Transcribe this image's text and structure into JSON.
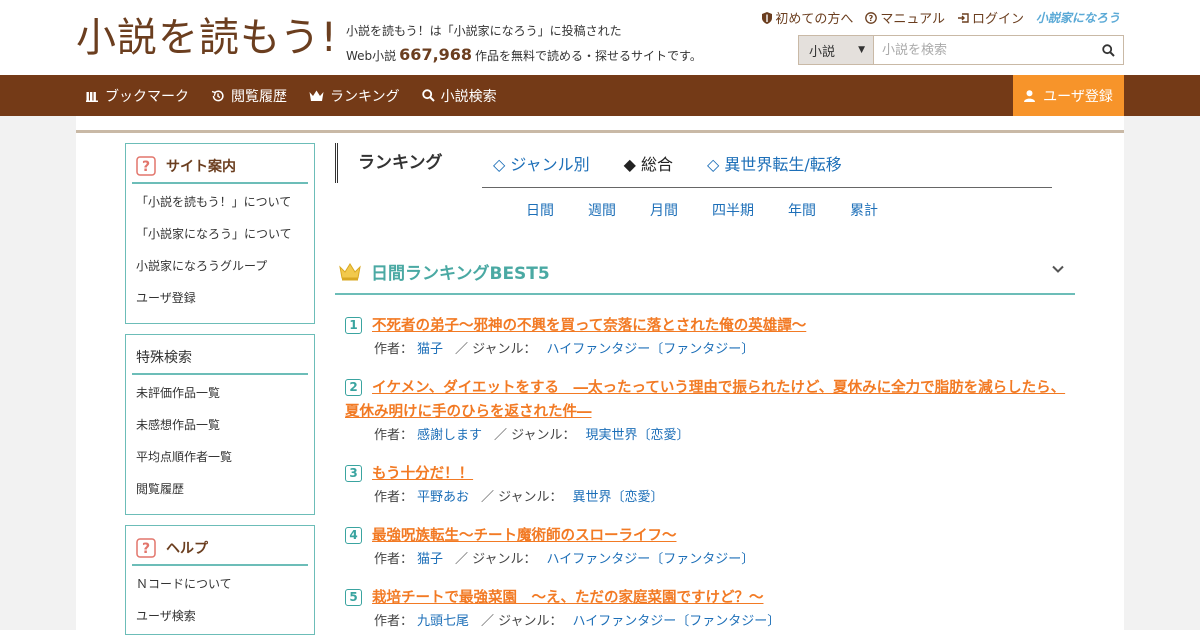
{
  "header": {
    "logo_main": "小説を読もう!",
    "tagline_line1": "小説を読もう！は「小説家になろう」に投稿された",
    "tagline_prefix": "Web小説",
    "work_count": "667,968",
    "tagline_suffix": "作品を無料で読める・探せるサイトです。",
    "top_links": [
      {
        "label": "初めての方へ",
        "icon": "shield-icon"
      },
      {
        "label": "マニュアル",
        "icon": "question-circle-icon"
      },
      {
        "label": "ログイン",
        "icon": "login-icon"
      }
    ],
    "narou_logo": "小説家になろう",
    "search": {
      "category": "小説",
      "placeholder": "小説を検索"
    }
  },
  "nav": {
    "items": [
      {
        "label": "ブックマーク",
        "icon": "bookshelf-icon"
      },
      {
        "label": "閲覧履歴",
        "icon": "history-icon"
      },
      {
        "label": "ランキング",
        "icon": "crown-icon"
      },
      {
        "label": "小説検索",
        "icon": "search-icon"
      }
    ],
    "register_label": "ユーザ登録"
  },
  "sidebar": {
    "site_guide": {
      "title": "サイト案内",
      "items": [
        "「小説を読もう！」について",
        "「小説家になろう」について",
        "小説家になろうグループ",
        "ユーザ登録"
      ]
    },
    "special_search": {
      "title": "特殊検索",
      "items": [
        "未評価作品一覧",
        "未感想作品一覧",
        "平均点順作者一覧",
        "閲覧履歴"
      ]
    },
    "help": {
      "title": "ヘルプ",
      "items": [
        "Ｎコードについて",
        "ユーザ検索"
      ]
    }
  },
  "ranking": {
    "heading": "ランキング",
    "tabs": [
      "◇ ジャンル別",
      "◆ 総合",
      "◇ 異世界転生/転移"
    ],
    "active_tab": 1,
    "periods": [
      "日間",
      "週間",
      "月間",
      "四半期",
      "年間",
      "累計"
    ],
    "best_title": "日間ランキングBEST5",
    "author_label": "作者：",
    "genre_label": "／ ジャンル：",
    "entries": [
      {
        "rank": "1",
        "title": "不死者の弟子～邪神の不興を買って奈落に落とされた俺の英雄譚～",
        "author": "猫子",
        "genre": "ハイファンタジー〔ファンタジー〕"
      },
      {
        "rank": "2",
        "title": "イケメン、ダイエットをする　―太ったっていう理由で振られたけど、夏休みに全力で脂肪を減らしたら、夏休み明けに手のひらを返された件―",
        "author": "感謝します",
        "genre": "現実世界〔恋愛〕"
      },
      {
        "rank": "3",
        "title": "もう十分だ！！",
        "author": "平野あお",
        "genre": "異世界〔恋愛〕"
      },
      {
        "rank": "4",
        "title": "最強呪族転生～チート魔術師のスローライフ～",
        "author": "猫子",
        "genre": "ハイファンタジー〔ファンタジー〕"
      },
      {
        "rank": "5",
        "title": "栽培チートで最強菜園　～え、ただの家庭菜園ですけど？～",
        "author": "九頭七尾",
        "genre": "ハイファンタジー〔ファンタジー〕"
      }
    ]
  },
  "colors": {
    "brand_brown": "#743a17",
    "accent_orange": "#f7942a",
    "teal": "#6cbdb8",
    "link_blue": "#1d6fb8",
    "title_orange": "#f27a24"
  }
}
